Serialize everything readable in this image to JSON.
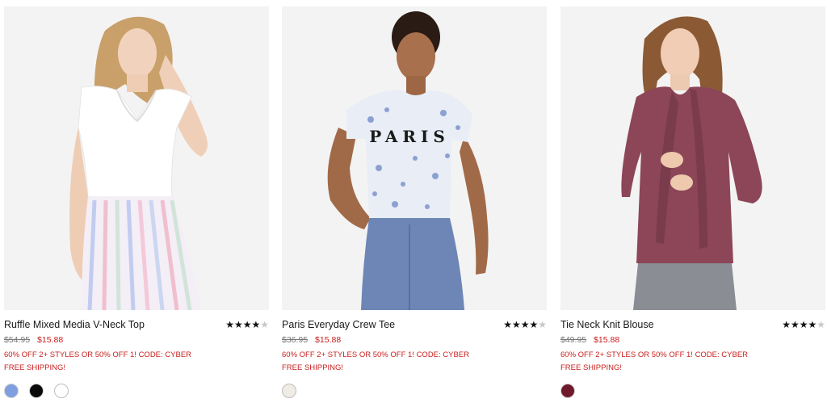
{
  "products": [
    {
      "title": "Ruffle Mixed Media V-Neck Top",
      "rating": 4,
      "stars": "★★★★★",
      "was_price": "$54.95",
      "now_price": "$15.88",
      "promo": "60% OFF 2+ STYLES OR 50% OFF 1! CODE: CYBER",
      "shipping": "FREE SHIPPING!",
      "swatches": [
        "#7f9fe0",
        "#0a0a0a",
        "#ffffff"
      ],
      "image": "model-white-ruffle-top-striped-skirt"
    },
    {
      "title": "Paris Everyday Crew Tee",
      "rating": 4,
      "stars": "★★★★★",
      "was_price": "$36.95",
      "now_price": "$15.88",
      "promo": "60% OFF 2+ STYLES OR 50% OFF 1! CODE: CYBER",
      "shipping": "FREE SHIPPING!",
      "swatches": [
        "#efece6"
      ],
      "image": "model-floral-paris-tee-blue-pants",
      "tee_text": "PARIS"
    },
    {
      "title": "Tie Neck Knit Blouse",
      "rating": 4,
      "stars": "★★★★★",
      "was_price": "$49.95",
      "now_price": "$15.88",
      "promo": "60% OFF 2+ STYLES OR 50% OFF 1! CODE: CYBER",
      "shipping": "FREE SHIPPING!",
      "swatches": [
        "#6e1a2c"
      ],
      "image": "model-burgundy-tie-neck-blouse-grey-jeans"
    }
  ],
  "colors": {
    "sale_red": "#c8201f",
    "photo_bg": "#f2f2f2"
  }
}
